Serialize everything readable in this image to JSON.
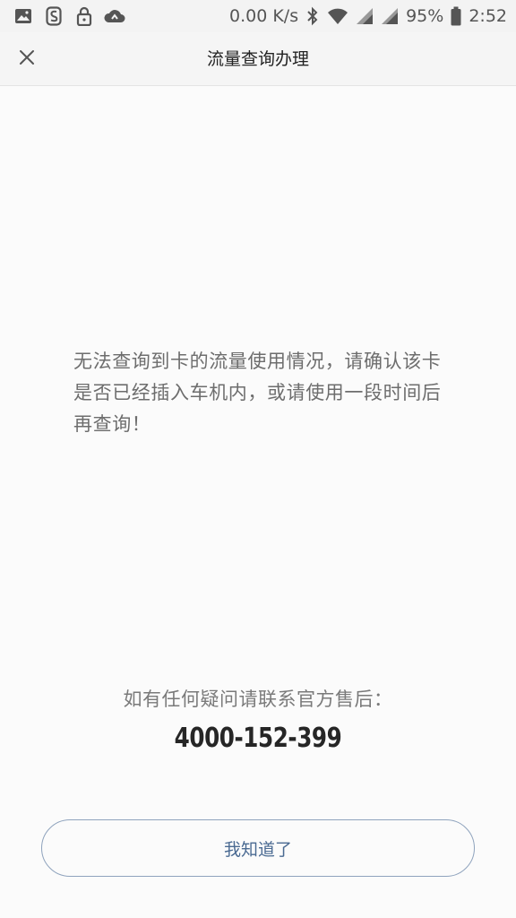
{
  "status_bar": {
    "net_speed": "0.00 K/s",
    "battery_percent": "95%",
    "time": "2:52",
    "icons": [
      "image-icon",
      "s-app-icon",
      "lock-icon",
      "cloud-icon",
      "bluetooth-icon",
      "wifi-icon",
      "signal-icon",
      "signal-icon",
      "battery-icon"
    ]
  },
  "header": {
    "title": "流量查询办理",
    "close_icon": "close-icon"
  },
  "main": {
    "message": "无法查询到卡的流量使用情况，请确认该卡是否已经插入车机内，或请使用一段时间后再查询！",
    "contact_label": "如有任何疑问请联系官方售后：",
    "phone": "4000-152-399"
  },
  "footer": {
    "ack_button_label": "我知道了"
  },
  "colors": {
    "accent": "#4a6a92",
    "button_border": "#8fa3bd",
    "text_secondary": "#6d6d6d",
    "background": "#fbfbfb"
  }
}
